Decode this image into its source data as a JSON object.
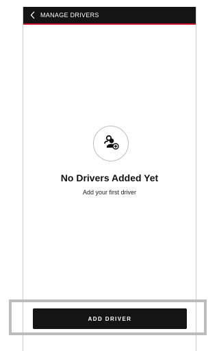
{
  "header": {
    "title": "MANAGE DRIVERS",
    "back_icon": "chevron-left-icon",
    "background": "#141414",
    "accent_line": "#c8102e"
  },
  "empty_state": {
    "icon": "add-driver-icon",
    "title": "No Drivers Added Yet",
    "subtitle": "Add your first driver"
  },
  "footer": {
    "add_driver_label": "ADD DRIVER"
  }
}
